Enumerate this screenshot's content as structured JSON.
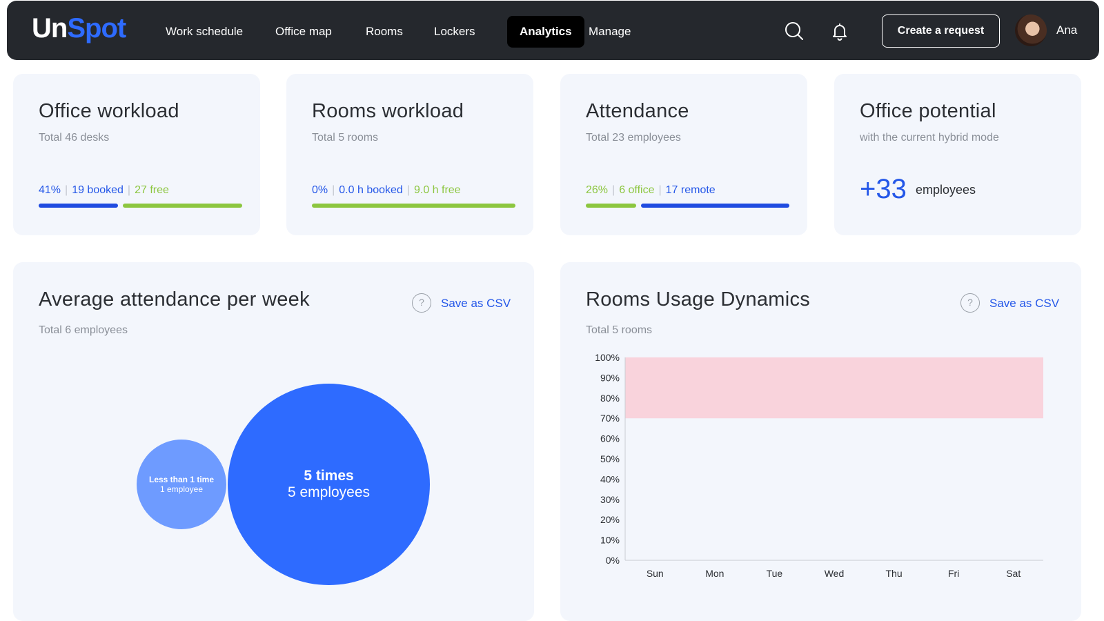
{
  "brand": {
    "part1": "Un",
    "part2": "Spot"
  },
  "nav": {
    "items": [
      {
        "label": "Work schedule"
      },
      {
        "label": "Office map"
      },
      {
        "label": "Rooms"
      },
      {
        "label": "Lockers"
      },
      {
        "label": "Analytics",
        "active": true
      },
      {
        "label": "Manage"
      }
    ]
  },
  "header": {
    "search_icon": "search-icon",
    "bell_icon": "bell-icon",
    "create_label": "Create a request",
    "user_name": "Ana"
  },
  "cards": {
    "office_workload": {
      "title": "Office workload",
      "subtitle": "Total 46 desks",
      "percent": "41%",
      "booked": "19 booked",
      "free": "27 free",
      "booked_fraction": 0.41
    },
    "rooms_workload": {
      "title": "Rooms workload",
      "subtitle": "Total 5 rooms",
      "percent": "0%",
      "booked": "0.0 h booked",
      "free": "9.0 h free",
      "booked_fraction": 0
    },
    "attendance": {
      "title": "Attendance",
      "subtitle": "Total 23 employees",
      "percent": "26%",
      "office": "6 office",
      "remote": "17 remote",
      "office_fraction": 0.26
    },
    "office_potential": {
      "title": "Office potential",
      "subtitle": "with the current hybrid mode",
      "value": "+33",
      "label": "employees"
    }
  },
  "avg_attendance": {
    "title": "Average attendance per week",
    "subtitle": "Total 6 employees",
    "help": "?",
    "csv_label": "Save as CSV",
    "bubbles": [
      {
        "title": "Less than 1 time",
        "sub": "1 employee",
        "value": 1
      },
      {
        "title": "5 times",
        "sub": "5 employees",
        "value": 5
      }
    ]
  },
  "rooms_usage": {
    "title": "Rooms Usage Dynamics",
    "subtitle": "Total 5 rooms",
    "help": "?",
    "csv_label": "Save as CSV"
  },
  "colors": {
    "accent_blue": "#2e6bff",
    "link_blue": "#2457e8",
    "green": "#8cc63f",
    "band_pink": "#f9d3dc"
  },
  "chart_data": {
    "type": "area",
    "title": "Rooms Usage Dynamics",
    "categories": [
      "Sun",
      "Mon",
      "Tue",
      "Wed",
      "Thu",
      "Fri",
      "Sat"
    ],
    "y_ticks": [
      "0%",
      "10%",
      "20%",
      "30%",
      "40%",
      "50%",
      "60%",
      "70%",
      "80%",
      "90%",
      "100%"
    ],
    "ylim": [
      0,
      100
    ],
    "series": [
      {
        "values": [
          0,
          0,
          0,
          0,
          0,
          0,
          0
        ]
      }
    ],
    "band": {
      "from": 70,
      "to": 100,
      "color": "#f9d3dc"
    },
    "grid": false
  }
}
